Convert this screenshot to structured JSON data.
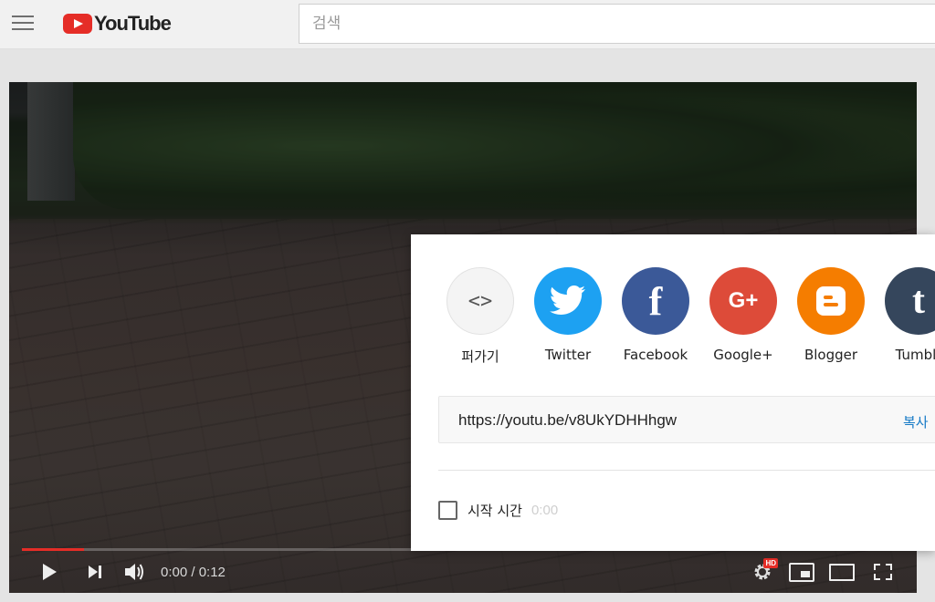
{
  "masthead": {
    "logo_text": "YouTube",
    "search_placeholder": "검색"
  },
  "player": {
    "time_display": "0:00 / 0:12",
    "progress_played_fraction": 0.07,
    "hd_badge": "HD"
  },
  "share": {
    "targets": [
      {
        "label": "퍼가기",
        "icon": "embed-icon",
        "glyph": "<>",
        "color": "#f4f4f4"
      },
      {
        "label": "Twitter",
        "icon": "twitter-icon",
        "color": "#1da1f2"
      },
      {
        "label": "Facebook",
        "icon": "facebook-icon",
        "glyph": "f",
        "color": "#3b5998"
      },
      {
        "label": "Google+",
        "icon": "google-plus-icon",
        "glyph": "G+",
        "color": "#dd4b39"
      },
      {
        "label": "Blogger",
        "icon": "blogger-icon",
        "color": "#f57d00"
      },
      {
        "label": "Tumblr",
        "icon": "tumblr-icon",
        "glyph": "t",
        "color": "#35465c"
      }
    ],
    "url": "https://youtu.be/v8UkYDHHhgw",
    "copy_label": "복사",
    "start_at_label": "시작 시간",
    "start_at_value": "0:00",
    "start_at_checked": false
  },
  "colors": {
    "brand_red": "#e52d27",
    "link_blue": "#167ac6"
  }
}
